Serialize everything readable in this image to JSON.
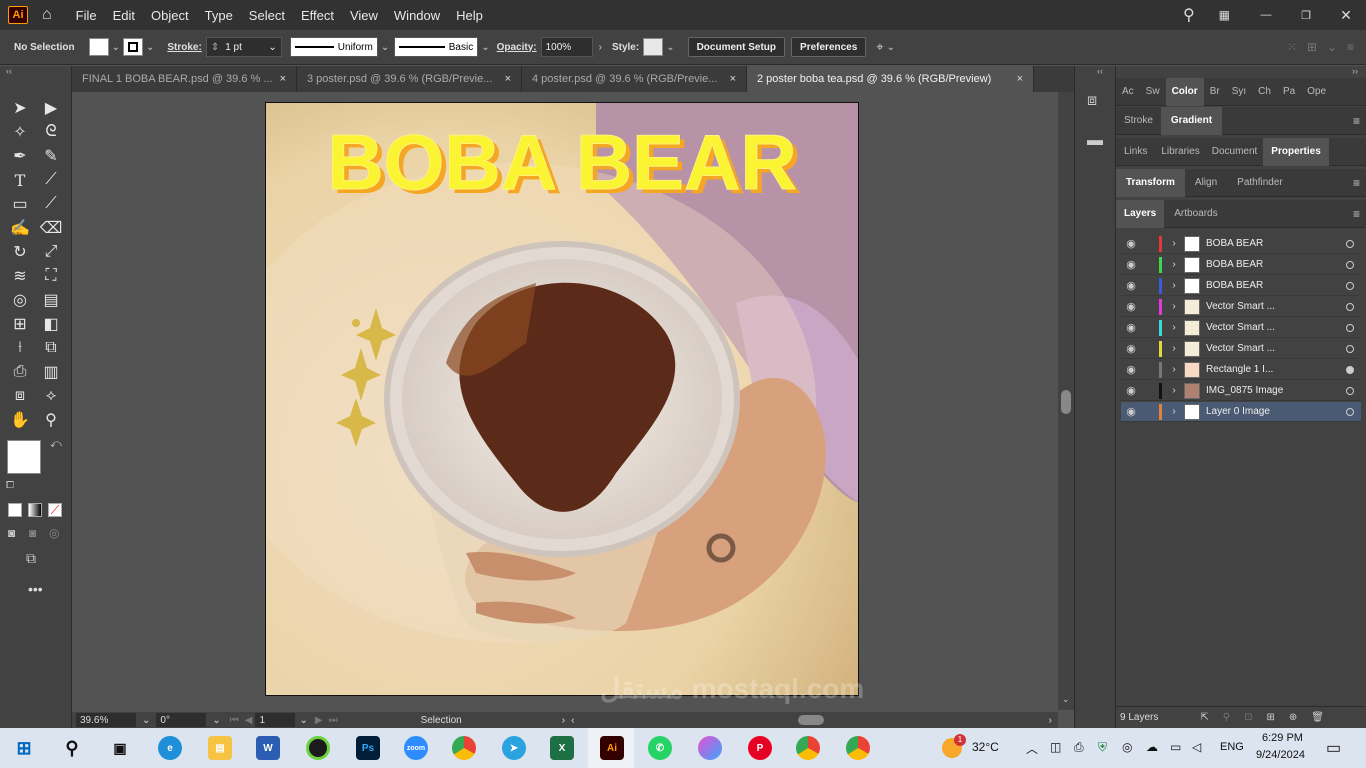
{
  "menubar": {
    "items": [
      "File",
      "Edit",
      "Object",
      "Type",
      "Select",
      "Effect",
      "View",
      "Window",
      "Help"
    ],
    "app_logo": "Ai"
  },
  "controlbar": {
    "selection_label": "No Selection",
    "stroke_label": "Stroke:",
    "stroke_value": "1 pt",
    "profile_value": "Uniform",
    "brush_value": "Basic",
    "opacity_label": "Opacity:",
    "opacity_value": "100%",
    "style_label": "Style:",
    "document_setup": "Document Setup",
    "preferences": "Preferences"
  },
  "tabs": [
    {
      "title": "FINAL 1 BOBA BEAR.psd @ 39.6 % ...",
      "close": "×"
    },
    {
      "title": "3 poster.psd @ 39.6 % (RGB/Previe...",
      "close": "×"
    },
    {
      "title": "4 poster.psd @ 39.6 % (RGB/Previe...",
      "close": "×"
    },
    {
      "title": "2 poster boba tea.psd @ 39.6 % (RGB/Preview)",
      "close": "×"
    }
  ],
  "artwork": {
    "headline": "BOBA BEAR"
  },
  "statusbar": {
    "zoom": "39.6%",
    "rotation": "0°",
    "artboard": "1",
    "tool": "Selection"
  },
  "panels": {
    "row1": [
      "Ac",
      "Sw",
      "Color",
      "Br",
      "Syı",
      "Ch",
      "Pa",
      "Ope"
    ],
    "row2": [
      "Stroke",
      "Gradient"
    ],
    "row3": [
      "Links",
      "Libraries",
      "Document",
      "Properties"
    ],
    "row4": [
      "Transform",
      "Align",
      "Pathfinder"
    ],
    "row5": [
      "Layers",
      "Artboards"
    ]
  },
  "layers": [
    {
      "name": "BOBA BEAR",
      "color": "#e03a3a",
      "target": "empty"
    },
    {
      "name": "BOBA BEAR",
      "color": "#3ad94e",
      "target": "empty"
    },
    {
      "name": "BOBA BEAR",
      "color": "#3a5ae0",
      "target": "empty"
    },
    {
      "name": "Vector Smart ...",
      "color": "#e03ad9",
      "target": "empty"
    },
    {
      "name": "Vector Smart ...",
      "color": "#3ad9e0",
      "target": "empty"
    },
    {
      "name": "Vector Smart ...",
      "color": "#e0d93a",
      "target": "empty"
    },
    {
      "name": "Rectangle 1 I...",
      "color": "#777777",
      "target": "filled"
    },
    {
      "name": "IMG_0875 Image",
      "color": "#111111",
      "target": "empty"
    },
    {
      "name": "Layer 0 Image",
      "color": "#e0823a",
      "target": "empty"
    }
  ],
  "layers_footer": "9 Layers",
  "taskbar": {
    "weather": "32°C",
    "lang": "ENG",
    "time": "6:29 PM",
    "date": "9/24/2024",
    "notif_count": "1"
  },
  "watermark": "مستقل mostaql.com"
}
